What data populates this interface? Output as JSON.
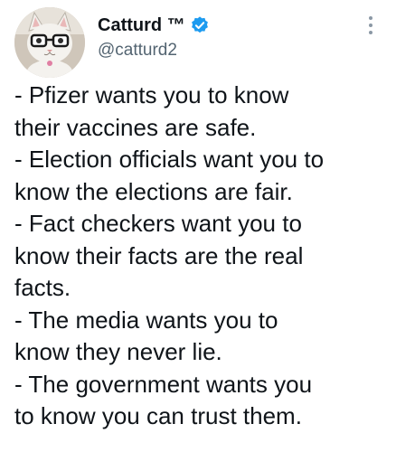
{
  "author": {
    "display_name": "Catturd ™",
    "handle": "@catturd2",
    "avatar_icon": "cat-with-glasses-avatar",
    "verified_icon": "verified-badge-icon",
    "verified_color": "#1d9bf0"
  },
  "menu": {
    "icon": "more-options-icon"
  },
  "tweet": {
    "lines": [
      "- Pfizer wants you to know",
      "their vaccines are safe.",
      "- Election officials want you to",
      "know the elections are fair.",
      "- Fact checkers want you to",
      "know their facts are the real",
      "facts.",
      "- The media wants you to",
      "know they never lie.",
      "- The government wants you",
      "to know you can trust them."
    ]
  }
}
